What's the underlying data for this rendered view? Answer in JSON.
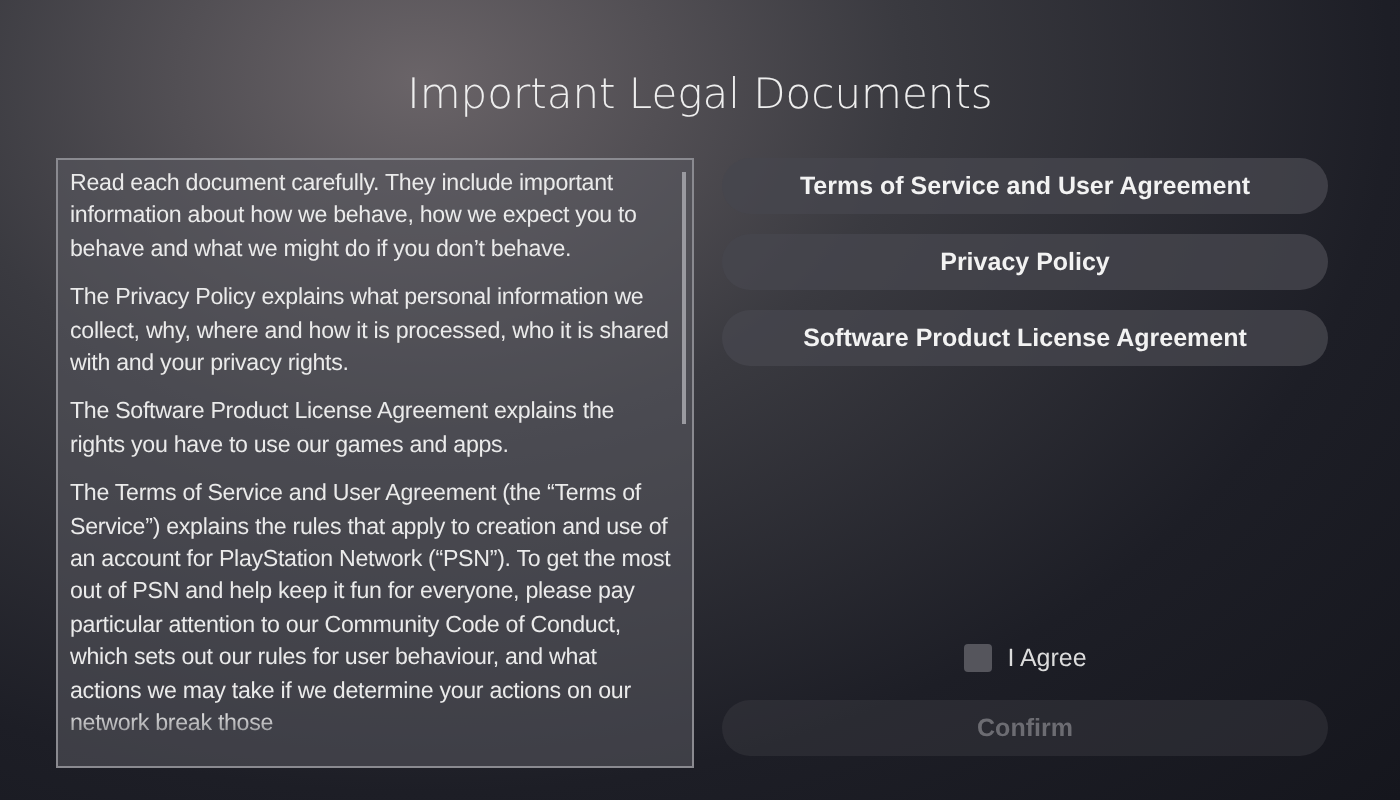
{
  "title": "Important Legal Documents",
  "document_text": {
    "paragraphs": [
      "Read each document carefully. They include important information about how we behave, how we expect you to behave and what we might do if you don’t behave.",
      "The Privacy Policy explains what personal information we collect, why, where and how it is processed, who it is shared with and your privacy rights.",
      "The Software Product License Agreement explains the rights you have to use our games and apps.",
      "The Terms of Service and User Agreement (the “Terms of Service”) explains the rules that apply to creation and use of an account for PlayStation Network (“PSN”). To get the most out of PSN and help keep it fun for everyone, please pay particular attention to our Community Code of Conduct, which sets out our rules for user behaviour, and what actions we may take if we determine your actions on our network break those"
    ]
  },
  "documents": [
    {
      "label": "Terms of Service and User Agreement"
    },
    {
      "label": "Privacy Policy"
    },
    {
      "label": "Software Product License Agreement"
    }
  ],
  "agree": {
    "label": "I Agree",
    "checked": false
  },
  "confirm": {
    "label": "Confirm",
    "disabled": true
  }
}
